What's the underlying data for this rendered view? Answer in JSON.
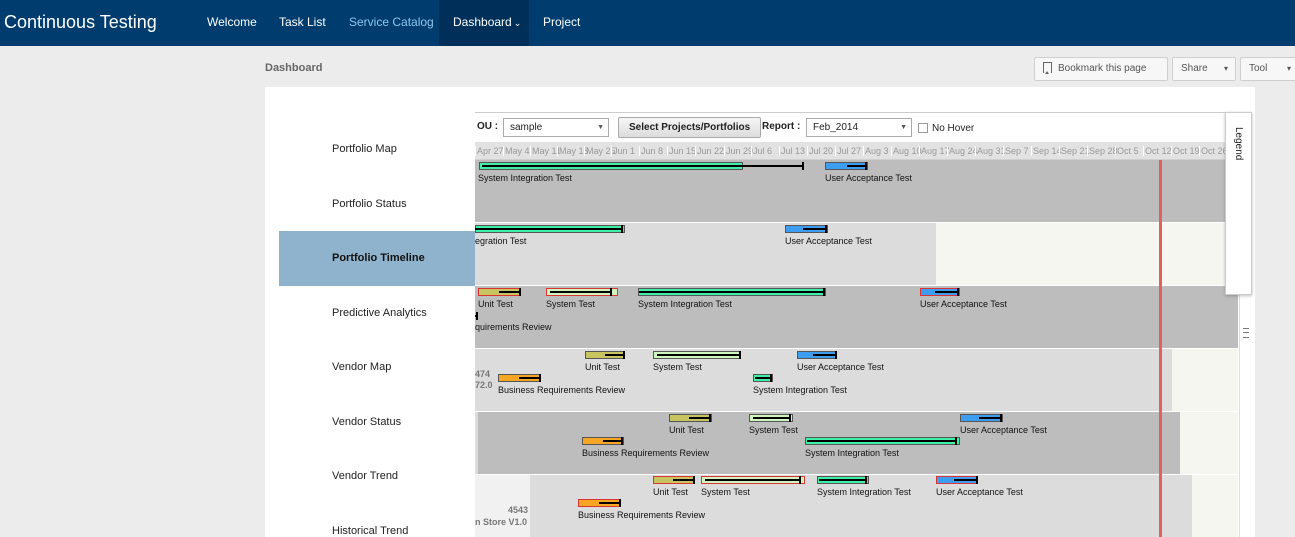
{
  "app": {
    "title": "Continuous Testing"
  },
  "nav": {
    "welcome": "Welcome",
    "tasks": "Task List",
    "catalog": "Service Catalog",
    "dashboard": "Dashboard",
    "project": "Project"
  },
  "page": {
    "title": "Dashboard",
    "bookmark": "Bookmark this page",
    "share": "Share",
    "tool": "Tool"
  },
  "sidebar": {
    "items": [
      {
        "label": "Portfolio Map"
      },
      {
        "label": "Portfolio Status"
      },
      {
        "label": "Portfolio Timeline"
      },
      {
        "label": "Predictive Analytics"
      },
      {
        "label": "Vendor Map"
      },
      {
        "label": "Vendor Status"
      },
      {
        "label": "Vendor Trend"
      },
      {
        "label": "Historical Trend"
      }
    ]
  },
  "controls": {
    "ou_label": "OU :",
    "ou_value": "sample",
    "select_button": "Select Projects/Portfolios",
    "report_label": "Report :",
    "report_value": "Feb_2014",
    "nohover": "No Hover"
  },
  "timeline": {
    "dates": [
      "Apr 27",
      "May 4",
      "May 11",
      "May 18",
      "May 25",
      "Jun 1",
      "Jun 8",
      "Jun 15",
      "Jun 22",
      "Jun 29",
      "Jul 6",
      "Jul 13",
      "Jul 20",
      "Jul 27",
      "Aug 3",
      "Aug 10",
      "Aug 17",
      "Aug 24",
      "Aug 31",
      "Sep 7",
      "Sep 14",
      "Sep 21",
      "Sep 28",
      "Oct 5",
      "Oct 12",
      "Oct 19",
      "Oct 26"
    ],
    "labels": {
      "sit": "System Integration Test",
      "uat": "User Acceptance Test",
      "sit_partial": "egration Test",
      "unit": "Unit Test",
      "st": "System Test",
      "brr": "Business Requirements Review",
      "brr_partial": "quirements Review",
      "r4_id_a": "474",
      "r4_id_b": "72.0",
      "r7_id_a": "4543",
      "r7_id_b": "n Store V1.0"
    }
  },
  "colors": {
    "nav_bg": "#003d6e",
    "active_side": "#8fb3cd",
    "sit": "#3df0a8",
    "uat": "#3d9df0",
    "unit": "#c8c460",
    "st": "#cff5bf",
    "brr": "#f5a623",
    "today": "#e26060"
  }
}
